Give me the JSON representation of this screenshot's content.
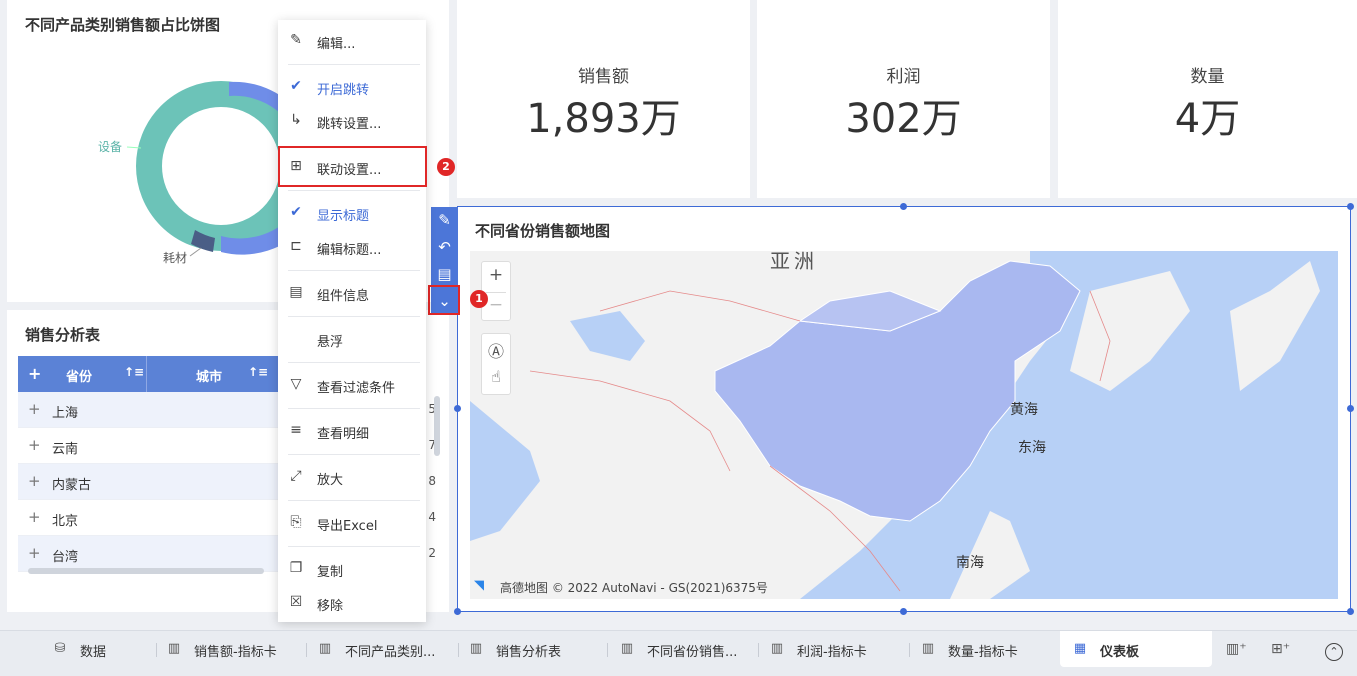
{
  "pie_panel": {
    "title": "不同产品类别销售额占比饼图",
    "labels": [
      "设备",
      "耗材"
    ],
    "colors": [
      "#6cc3b8",
      "#6f8de8",
      "#4a5e86"
    ]
  },
  "kpis": [
    {
      "label": "销售额",
      "value": "1,893万"
    },
    {
      "label": "利润",
      "value": "302万"
    },
    {
      "label": "数量",
      "value": "4万"
    }
  ],
  "table_panel": {
    "title": "销售分析表",
    "columns": [
      "省份",
      "城市"
    ],
    "rows": [
      {
        "province": "上海",
        "tail": "5"
      },
      {
        "province": "云南",
        "tail": "7"
      },
      {
        "province": "内蒙古",
        "tail": "8"
      },
      {
        "province": "北京",
        "tail": "4"
      },
      {
        "province": "台湾",
        "tail": "2"
      }
    ]
  },
  "context_menu": {
    "items": [
      {
        "label": "编辑...",
        "icon": "pencil-icon"
      },
      {
        "label": "开启跳转",
        "icon": "check-icon",
        "checked": true
      },
      {
        "label": "跳转设置...",
        "icon": "redirect-arrow-icon"
      },
      {
        "label": "联动设置...",
        "icon": "link-nodes-icon"
      },
      {
        "label": "显示标题",
        "icon": "check-icon",
        "checked": true
      },
      {
        "label": "编辑标题...",
        "icon": "edit-title-icon"
      },
      {
        "label": "组件信息",
        "icon": "info-comment-icon"
      },
      {
        "label": "悬浮",
        "icon": ""
      },
      {
        "label": "查看过滤条件",
        "icon": "filter-icon"
      },
      {
        "label": "查看明细",
        "icon": "detail-search-icon"
      },
      {
        "label": "放大",
        "icon": "expand-icon"
      },
      {
        "label": "导出Excel",
        "icon": "export-icon"
      },
      {
        "label": "复制",
        "icon": "copy-icon"
      },
      {
        "label": "移除",
        "icon": "remove-icon"
      }
    ]
  },
  "badges": {
    "first": "1",
    "second": "2"
  },
  "map_panel": {
    "title": "不同省份销售额地图",
    "labels": {
      "asia": "亚洲",
      "yellow_sea": "黄海",
      "east_sea": "东海",
      "south_sea": "南海"
    },
    "zoom_in": "+",
    "zoom_out": "−",
    "attribution": "高德地图 © 2022 AutoNavi - GS(2021)6375号"
  },
  "bottom_tabs": [
    {
      "label": "数据",
      "icon": "database-icon"
    },
    {
      "label": "销售额-指标卡",
      "icon": "chart-icon"
    },
    {
      "label": "不同产品类别...",
      "icon": "chart-icon"
    },
    {
      "label": "销售分析表",
      "icon": "chart-icon"
    },
    {
      "label": "不同省份销售...",
      "icon": "chart-icon"
    },
    {
      "label": "利润-指标卡",
      "icon": "chart-icon"
    },
    {
      "label": "数量-指标卡",
      "icon": "chart-icon"
    },
    {
      "label": "仪表板",
      "icon": "dashboard-icon",
      "active": true
    }
  ],
  "colors": {
    "accent": "#3d6ad6",
    "highlight": "#e02727",
    "map_water": "#b7d0f6",
    "map_land": "#f2f2f2",
    "map_china": "#a9b8f0"
  }
}
